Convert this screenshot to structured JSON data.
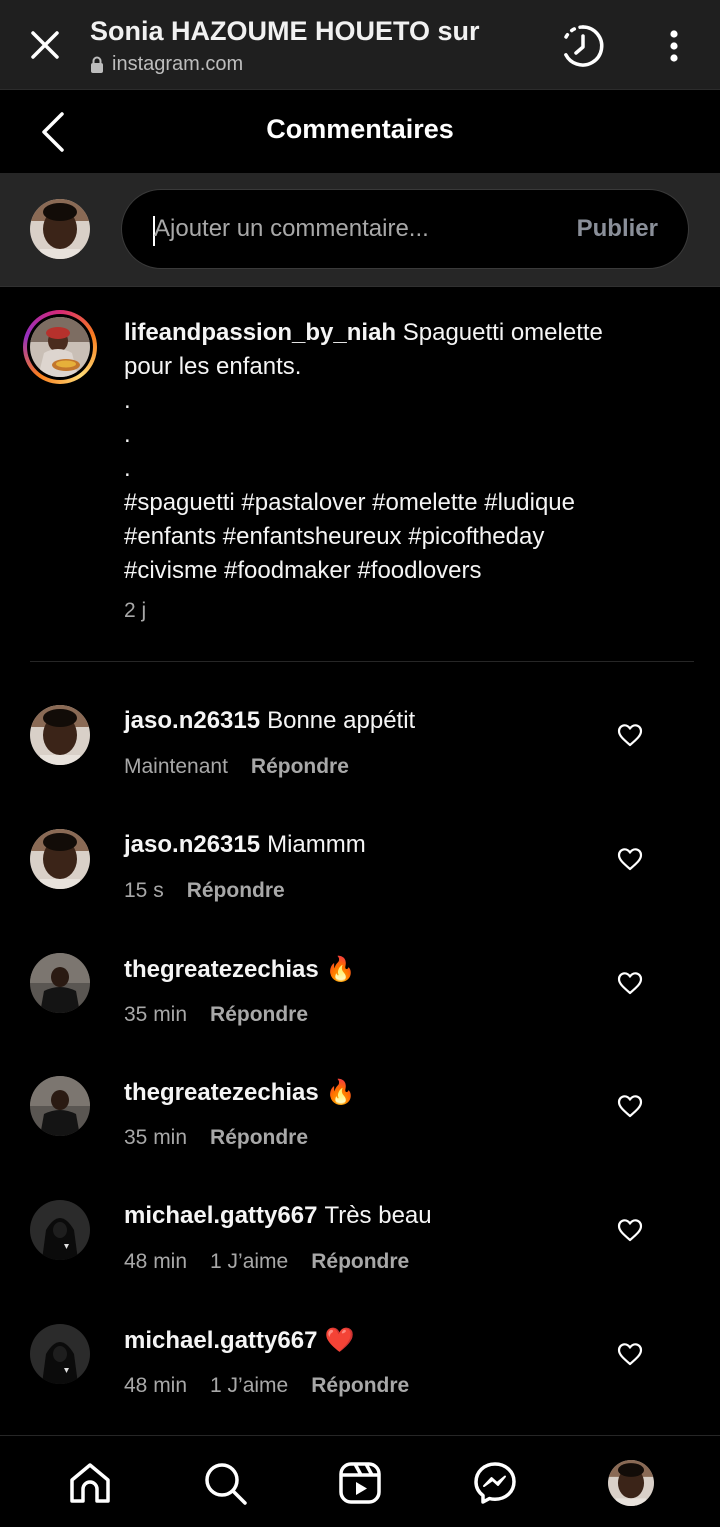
{
  "browser": {
    "title": "Sonia HAZOUME HOUETO sur",
    "url": "instagram.com"
  },
  "header": {
    "title": "Commentaires"
  },
  "compose": {
    "placeholder": "Ajouter un commentaire...",
    "publish_label": "Publier"
  },
  "caption": {
    "username": "lifeandpassion_by_niah",
    "lines": [
      "Spaguetti omelette",
      "pour les enfants.",
      ".",
      ".",
      ".",
      "#spaguetti #pastalover #omelette #ludique",
      "#enfants #enfantsheureux #picoftheday",
      "#civisme #foodmaker #foodlovers"
    ],
    "time": "2 j"
  },
  "comments": [
    {
      "username": "jaso.n26315",
      "text": "Bonne appétit",
      "time": "Maintenant",
      "likes": "",
      "reply": "Répondre",
      "avatar": "face"
    },
    {
      "username": "jaso.n26315",
      "text": "Miammm",
      "time": "15 s",
      "likes": "",
      "reply": "Répondre",
      "avatar": "face"
    },
    {
      "username": "thegreatezechias",
      "text": "🔥",
      "time": "35 min",
      "likes": "",
      "reply": "Répondre",
      "avatar": "dark"
    },
    {
      "username": "thegreatezechias",
      "text": "🔥",
      "time": "35 min",
      "likes": "",
      "reply": "Répondre",
      "avatar": "dark"
    },
    {
      "username": "michael.gatty667",
      "text": "Très beau",
      "time": "48 min",
      "likes": "1 J’aime",
      "reply": "Répondre",
      "avatar": "hood"
    },
    {
      "username": "michael.gatty667",
      "text": "❤️",
      "time": "48 min",
      "likes": "1 J’aime",
      "reply": "Répondre",
      "avatar": "hood"
    }
  ],
  "nav": {
    "icons": [
      "home-icon",
      "search-icon",
      "reels-icon",
      "messenger-icon",
      "profile-avatar"
    ]
  },
  "colors": {
    "background": "#000000",
    "secondary_text": "#a8a8a8",
    "publish_disabled": "#8a8f99",
    "fire": "#ff6a00",
    "heart": "#e8202d"
  }
}
